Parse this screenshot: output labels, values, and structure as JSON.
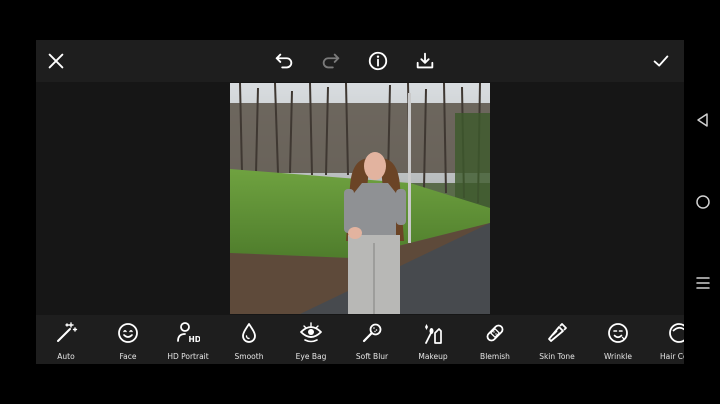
{
  "topbar": {
    "icons": [
      "close-icon",
      "undo-icon",
      "redo-icon",
      "info-icon",
      "download-icon",
      "check-icon"
    ]
  },
  "tools": [
    {
      "label": "Auto",
      "icon": "magic-wand-icon"
    },
    {
      "label": "Face",
      "icon": "smiley-face-icon"
    },
    {
      "label": "HD Portrait",
      "icon": "hd-portrait-icon"
    },
    {
      "label": "Smooth",
      "icon": "droplet-icon"
    },
    {
      "label": "Eye Bag",
      "icon": "eye-icon"
    },
    {
      "label": "Soft Blur",
      "icon": "brush-icon"
    },
    {
      "label": "Makeup",
      "icon": "makeup-icon"
    },
    {
      "label": "Blemish",
      "icon": "bandage-icon"
    },
    {
      "label": "Skin Tone",
      "icon": "tube-icon"
    },
    {
      "label": "Wrinkle",
      "icon": "wrinkle-face-icon"
    },
    {
      "label": "Hair Co",
      "icon": "hair-icon"
    }
  ],
  "nav": {
    "icons": [
      "back-triangle-icon",
      "home-circle-icon",
      "recents-lines-icon"
    ]
  },
  "colors": {
    "background": "#161616",
    "bar": "#1e1e1e",
    "icon": "#ffffff",
    "muted_icon": "#7a7a7a"
  }
}
